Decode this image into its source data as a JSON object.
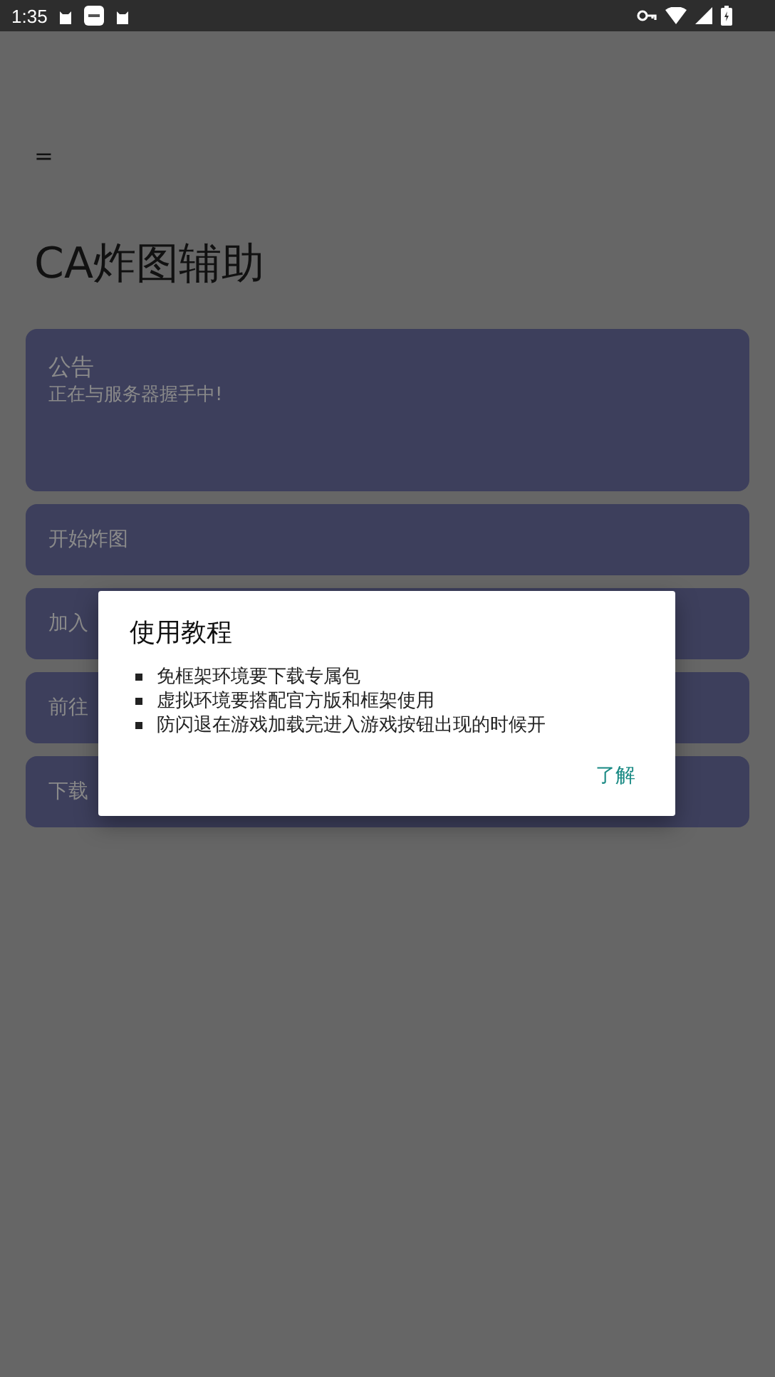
{
  "status_bar": {
    "time": "1:35"
  },
  "menu_icon": "=",
  "title": "CA炸图辅助",
  "notice": {
    "title": "公告",
    "text": "正在与服务器握手中!"
  },
  "buttons": [
    {
      "label": "开始炸图"
    },
    {
      "label": "加入"
    },
    {
      "label": "前往"
    },
    {
      "label": "下载"
    }
  ],
  "dialog": {
    "title": "使用教程",
    "items": [
      "免框架环境要下载专属包",
      "虚拟环境要搭配官方版和框架使用",
      "防闪退在游戏加载完进入游戏按钮出现的时候开"
    ],
    "action": "了解"
  }
}
